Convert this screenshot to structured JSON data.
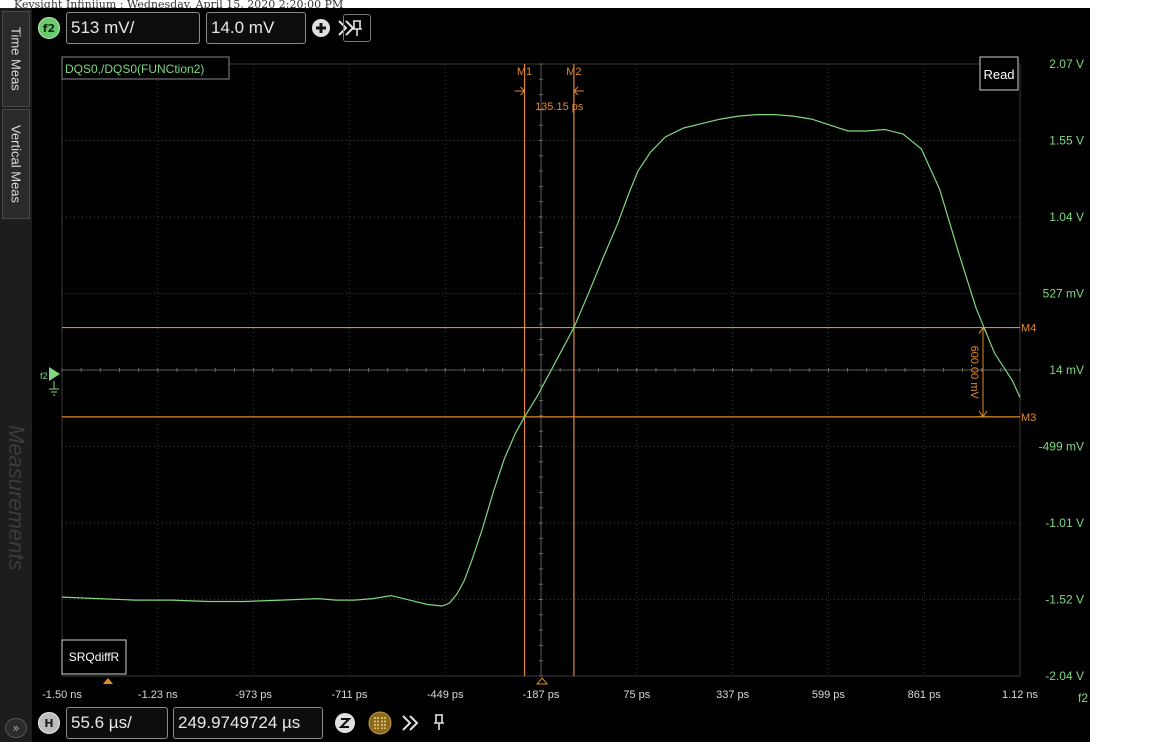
{
  "window": {
    "title": "Keysight Infiniium : Wednesday, April 15, 2020 2:20:00 PM"
  },
  "side_panel": {
    "tabs": [
      "Time Meas",
      "Vertical Meas"
    ],
    "watermark": "Measurements",
    "expand_glyph": "»"
  },
  "top_toolbar": {
    "channel_badge": "f2",
    "scale": "513 mV/",
    "offset": "14.0 mV",
    "icons": [
      "plus-icon",
      "double-chevron-icon",
      "pin-icon"
    ]
  },
  "bottom_toolbar": {
    "horizontal_badge": "H",
    "timebase": "55.6 µs/",
    "position": "249.9749724 µs",
    "icons": [
      "zoom-icon",
      "acquisition-icon",
      "double-chevron-icon",
      "pin-icon"
    ]
  },
  "waveform": {
    "label": "DQS0,/DQS0(FUNCtion2)",
    "channel_marker": "f2",
    "read_label": "Read",
    "bus_label": "SRQdiffR",
    "right_edge_label": "f2",
    "color": "#7fd87f"
  },
  "markers": {
    "color": "#e08a2c",
    "M1": {
      "label": "M1",
      "time_ps": -235
    },
    "M2": {
      "label": "M2",
      "time_ps": -100
    },
    "M3": {
      "label": "M3",
      "volts": -0.3
    },
    "M4": {
      "label": "M4",
      "volts": 0.3
    },
    "delta_time": "135.15 ps",
    "delta_volts": "600.00 mV"
  },
  "axes": {
    "x_ticks": [
      "-1.50 ns",
      "-1.23 ns",
      "-973 ps",
      "-711 ps",
      "-449 ps",
      "-187 ps",
      "75 ps",
      "337 ps",
      "599 ps",
      "861 ps",
      "1.12 ns"
    ],
    "y_ticks": [
      "2.07 V",
      "1.55 V",
      "1.04 V",
      "527 mV",
      "14 mV",
      "-499 mV",
      "-1.01 V",
      "-1.52 V",
      "-2.04 V"
    ],
    "x_range_ps": [
      -1500,
      1120
    ],
    "y_range_v": [
      -2.04,
      2.07
    ]
  },
  "chart_data": {
    "type": "line",
    "title": "DQS0,/DQS0(FUNCtion2)",
    "xlabel": "",
    "ylabel": "",
    "xlim": [
      -1500,
      1120
    ],
    "ylim": [
      -2.04,
      2.07
    ],
    "x_ticks": [
      "-1.50 ns",
      "-1.23 ns",
      "-973 ps",
      "-711 ps",
      "-449 ps",
      "-187 ps",
      "75 ps",
      "337 ps",
      "599 ps",
      "861 ps",
      "1.12 ns"
    ],
    "y_ticks": [
      "2.07 V",
      "1.55 V",
      "1.04 V",
      "527 mV",
      "14 mV",
      "-499 mV",
      "-1.01 V",
      "-1.52 V",
      "-2.04 V"
    ],
    "grid": true,
    "series": [
      {
        "name": "DQS0,/DQS0(FUNCtion2)",
        "x": [
          -1500,
          -1400,
          -1300,
          -1200,
          -1100,
          -1000,
          -900,
          -800,
          -750,
          -700,
          -650,
          -600,
          -550,
          -500,
          -460,
          -440,
          -420,
          -400,
          -380,
          -350,
          -320,
          -290,
          -260,
          -235,
          -200,
          -150,
          -100,
          -60,
          -20,
          20,
          50,
          75,
          110,
          150,
          200,
          250,
          300,
          350,
          400,
          450,
          500,
          550,
          600,
          650,
          700,
          750,
          800,
          850,
          900,
          950,
          1000,
          1050,
          1100,
          1120
        ],
        "y": [
          -1.51,
          -1.52,
          -1.53,
          -1.53,
          -1.54,
          -1.54,
          -1.53,
          -1.52,
          -1.53,
          -1.53,
          -1.52,
          -1.5,
          -1.53,
          -1.56,
          -1.57,
          -1.55,
          -1.49,
          -1.4,
          -1.27,
          -1.05,
          -0.8,
          -0.58,
          -0.41,
          -0.3,
          -0.16,
          0.07,
          0.3,
          0.53,
          0.77,
          1.0,
          1.2,
          1.35,
          1.48,
          1.58,
          1.64,
          1.67,
          1.7,
          1.72,
          1.73,
          1.73,
          1.72,
          1.7,
          1.66,
          1.62,
          1.62,
          1.63,
          1.6,
          1.5,
          1.23,
          0.82,
          0.43,
          0.13,
          -0.06,
          -0.17
        ]
      }
    ],
    "markers": {
      "time_ps": [
        -235,
        -100
      ],
      "volts": [
        -0.3,
        0.3
      ],
      "delta_time": "135.15 ps",
      "delta_volts": "600.00 mV"
    }
  }
}
